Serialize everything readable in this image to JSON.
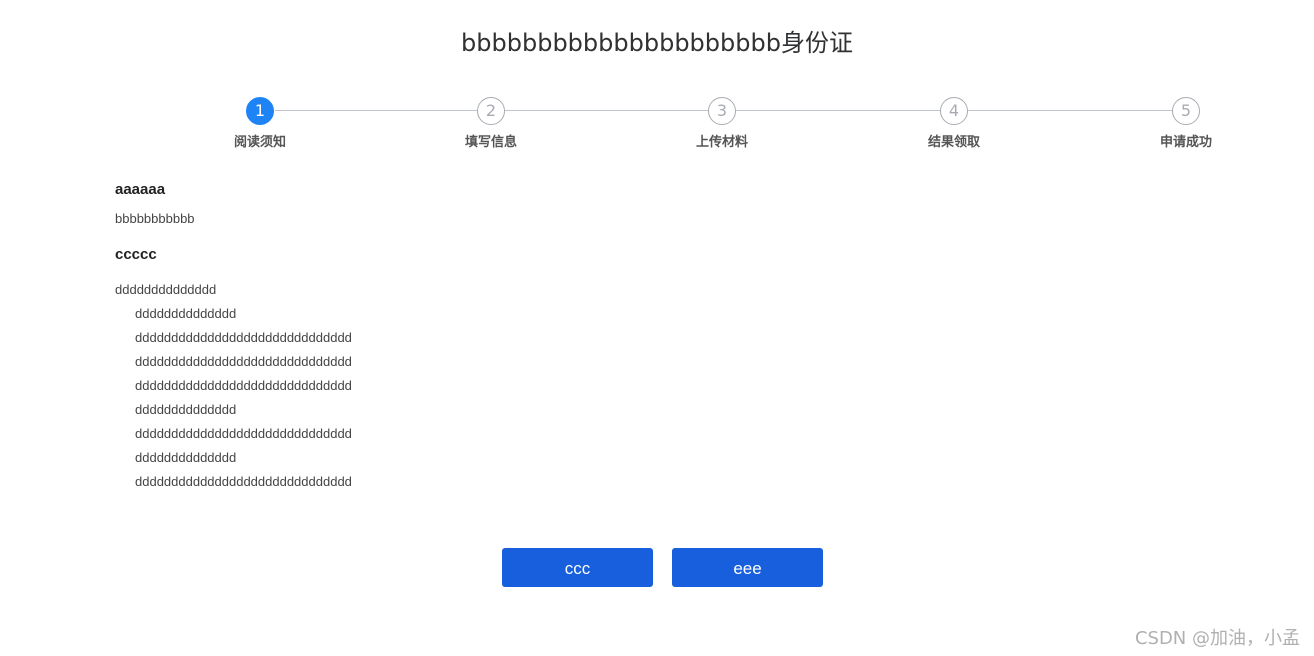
{
  "page": {
    "title": "bbbbbbbbbbbbbbbbbbbbb身份证"
  },
  "steps": [
    {
      "number": "1",
      "label": "阅读须知",
      "active": true
    },
    {
      "number": "2",
      "label": "填写信息",
      "active": false
    },
    {
      "number": "3",
      "label": "上传材料",
      "active": false
    },
    {
      "number": "4",
      "label": "结果领取",
      "active": false
    },
    {
      "number": "5",
      "label": "申请成功",
      "active": false
    }
  ],
  "notice": {
    "section1": {
      "heading": "aaaaaa",
      "text": "bbbbbbbbbbb"
    },
    "section2": {
      "heading": "ccccc",
      "lines": [
        "dddddddddddddd",
        "dddddddddddddd",
        "dddddddddddddddddddddddddddddd",
        "dddddddddddddddddddddddddddddd",
        "dddddddddddddddddddddddddddddd",
        "dddddddddddddd",
        "dddddddddddddddddddddddddddddd",
        "dddddddddddddd",
        "dddddddddddddddddddddddddddddd"
      ]
    }
  },
  "buttons": {
    "first_label": "ccc",
    "second_label": "eee"
  },
  "watermark": "CSDN @加油，小孟",
  "colors": {
    "active_step": "#1e84f5",
    "button": "#175fdc",
    "inactive_step": "#a8abb2"
  }
}
